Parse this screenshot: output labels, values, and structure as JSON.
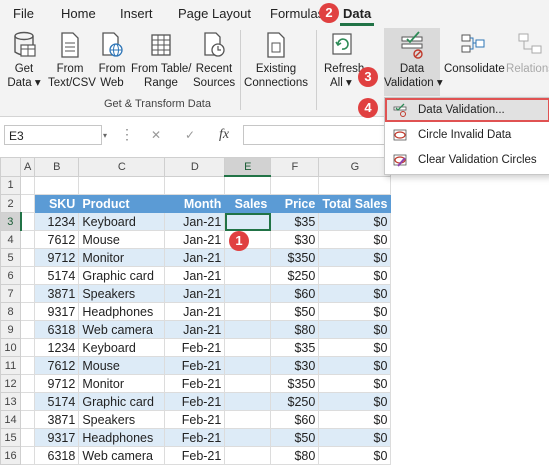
{
  "tabs": [
    {
      "label": "File"
    },
    {
      "label": "Home"
    },
    {
      "label": "Insert"
    },
    {
      "label": "Page Layout"
    },
    {
      "label": "Formulas"
    },
    {
      "label": "Data"
    }
  ],
  "ribbon": {
    "get_data": [
      "Get",
      "Data ▾"
    ],
    "from_text": [
      "From",
      "Text/CSV"
    ],
    "from_web": [
      "From",
      "Web"
    ],
    "from_table": [
      "From Table/",
      "Range"
    ],
    "recent_sources": [
      "Recent",
      "Sources"
    ],
    "existing_connections": [
      "Existing",
      "Connections"
    ],
    "refresh_all": [
      "Refresh",
      "All ▾"
    ],
    "data_validation": [
      "Data",
      "Validation ▾"
    ],
    "consolidate": "Consolidate",
    "relations": "Relations",
    "group_label": "Get & Transform Data"
  },
  "formula_bar": {
    "name_box": "E3",
    "cancel": "✕",
    "enter": "✓",
    "fx": "fx"
  },
  "columns": [
    "A",
    "B",
    "C",
    "D",
    "E",
    "F",
    "G"
  ],
  "headers": [
    "SKU",
    "Product",
    "Month",
    "Sales",
    "Price",
    "Total Sales"
  ],
  "rows": [
    {
      "sku": "1234",
      "product": "Keyboard",
      "month": "Jan-21",
      "sales": "",
      "price": "$35",
      "total": "$0"
    },
    {
      "sku": "7612",
      "product": "Mouse",
      "month": "Jan-21",
      "sales": "",
      "price": "$30",
      "total": "$0"
    },
    {
      "sku": "9712",
      "product": "Monitor",
      "month": "Jan-21",
      "sales": "",
      "price": "$350",
      "total": "$0"
    },
    {
      "sku": "5174",
      "product": "Graphic card",
      "month": "Jan-21",
      "sales": "",
      "price": "$250",
      "total": "$0"
    },
    {
      "sku": "3871",
      "product": "Speakers",
      "month": "Jan-21",
      "sales": "",
      "price": "$60",
      "total": "$0"
    },
    {
      "sku": "9317",
      "product": "Headphones",
      "month": "Jan-21",
      "sales": "",
      "price": "$50",
      "total": "$0"
    },
    {
      "sku": "6318",
      "product": "Web camera",
      "month": "Jan-21",
      "sales": "",
      "price": "$80",
      "total": "$0"
    },
    {
      "sku": "1234",
      "product": "Keyboard",
      "month": "Feb-21",
      "sales": "",
      "price": "$35",
      "total": "$0"
    },
    {
      "sku": "7612",
      "product": "Mouse",
      "month": "Feb-21",
      "sales": "",
      "price": "$30",
      "total": "$0"
    },
    {
      "sku": "9712",
      "product": "Monitor",
      "month": "Feb-21",
      "sales": "",
      "price": "$350",
      "total": "$0"
    },
    {
      "sku": "5174",
      "product": "Graphic card",
      "month": "Feb-21",
      "sales": "",
      "price": "$250",
      "total": "$0"
    },
    {
      "sku": "3871",
      "product": "Speakers",
      "month": "Feb-21",
      "sales": "",
      "price": "$60",
      "total": "$0"
    },
    {
      "sku": "9317",
      "product": "Headphones",
      "month": "Feb-21",
      "sales": "",
      "price": "$50",
      "total": "$0"
    },
    {
      "sku": "6318",
      "product": "Web camera",
      "month": "Feb-21",
      "sales": "",
      "price": "$80",
      "total": "$0"
    }
  ],
  "dropdown": {
    "items": [
      {
        "label": "Data Validation..."
      },
      {
        "label": "Circle Invalid Data"
      },
      {
        "label": "Clear Validation Circles"
      }
    ]
  },
  "callouts": [
    "1",
    "2",
    "3",
    "4"
  ],
  "colors": {
    "accent": "#217346",
    "header_fill": "#5b9bd5",
    "band_fill": "#ddebf7",
    "callout": "#e04040"
  }
}
